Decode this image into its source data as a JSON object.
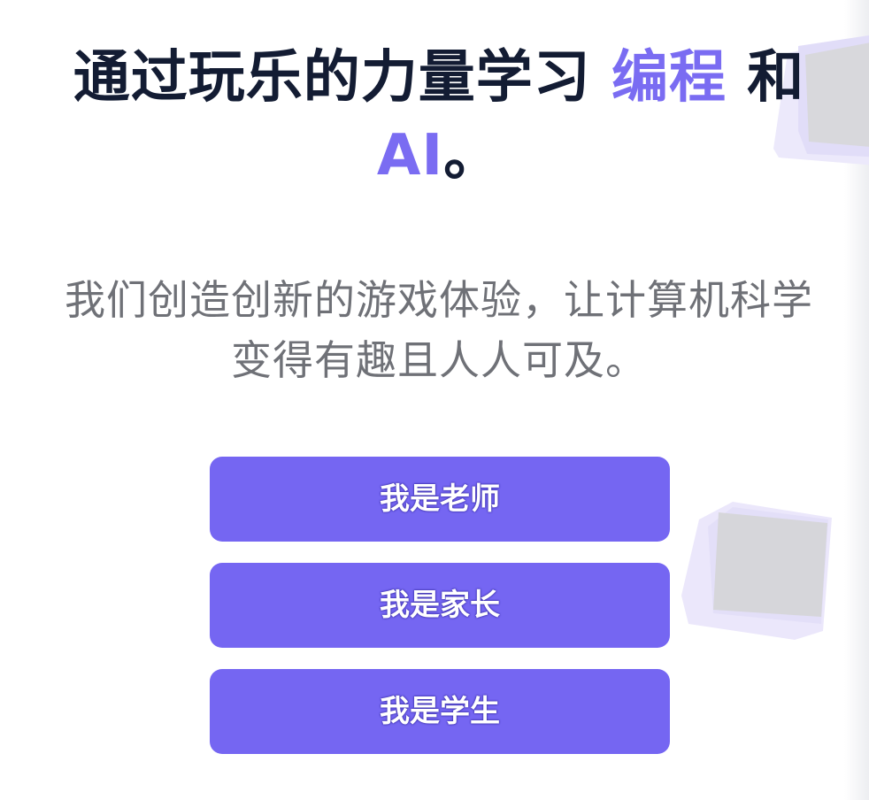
{
  "hero": {
    "title_part1": "通过玩乐的力量学习 ",
    "title_accent1": "编程",
    "title_part2": " 和",
    "title_accent2": "AI",
    "title_part3": "。",
    "subtitle_line1": "我们创造创新的游戏体验，让计算机科学",
    "subtitle_line2": "变得有趣且人人可及。"
  },
  "roles": {
    "teacher": "我是老师",
    "parent": "我是家长",
    "student": "我是学生"
  },
  "colors": {
    "accent": "#7a6cf2",
    "button": "#7566f2",
    "title": "#131c33",
    "subtitle": "#6f7177"
  },
  "icons": {
    "decoration_top": "cube-icon",
    "decoration_mid": "cube-icon"
  }
}
